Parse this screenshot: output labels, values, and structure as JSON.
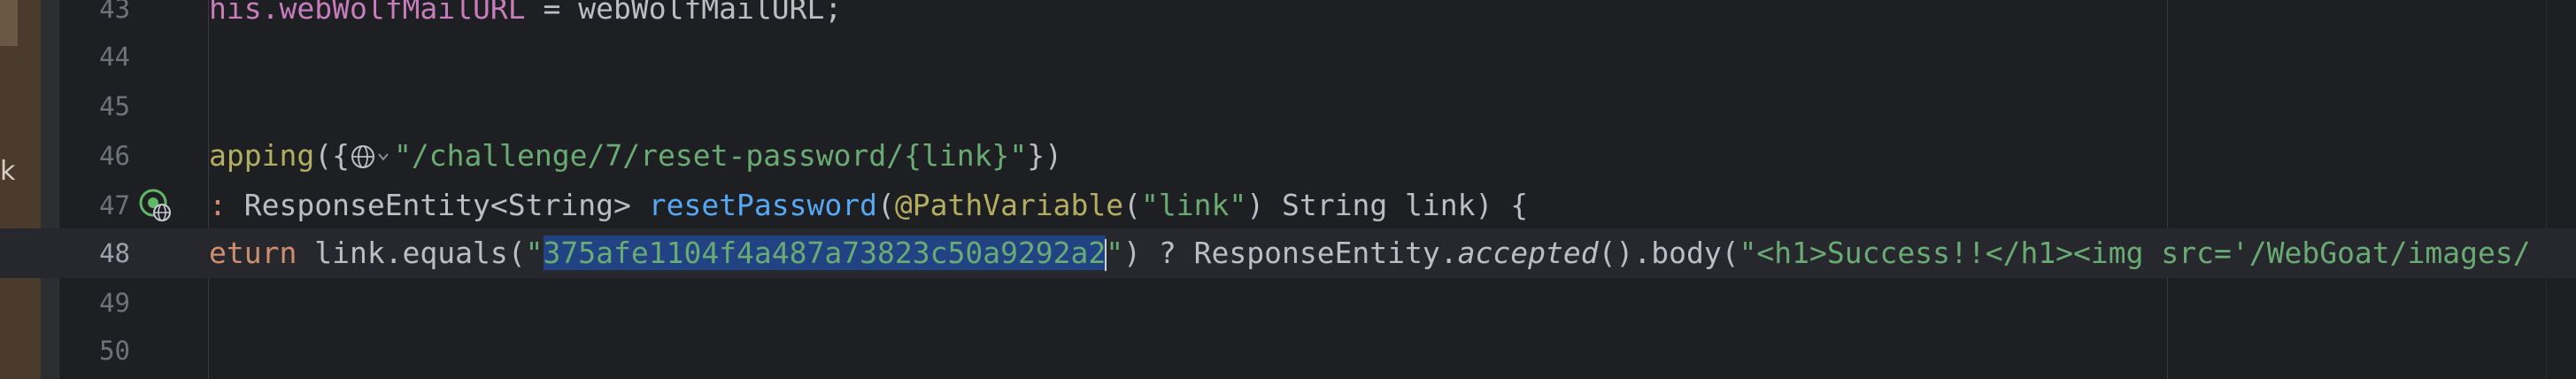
{
  "sidebar": {
    "label": "k"
  },
  "editor": {
    "lines": [
      {
        "number": "43",
        "segments": [
          {
            "cls": "field",
            "text": "his.webWolfMailURL"
          },
          {
            "cls": "",
            "text": " = webWolfMailURL;"
          }
        ]
      },
      {
        "number": "44",
        "segments": []
      },
      {
        "number": "45",
        "segments": []
      },
      {
        "number": "46",
        "segments": [
          {
            "cls": "ann",
            "text": "apping"
          },
          {
            "cls": "",
            "text": "({"
          },
          {
            "cls": "icon",
            "text": ""
          },
          {
            "cls": "str",
            "text": "\"/challenge/7/reset-password/{link}\""
          },
          {
            "cls": "",
            "text": "})"
          }
        ]
      },
      {
        "number": "47",
        "segments": [
          {
            "cls": "kw",
            "text": ": "
          },
          {
            "cls": "",
            "text": "ResponseEntity<String> "
          },
          {
            "cls": "fn",
            "text": "resetPassword"
          },
          {
            "cls": "",
            "text": "("
          },
          {
            "cls": "ann",
            "text": "@PathVariable"
          },
          {
            "cls": "",
            "text": "("
          },
          {
            "cls": "str",
            "text": "\"link\""
          },
          {
            "cls": "",
            "text": ") String link) {"
          }
        ]
      },
      {
        "number": "48",
        "current": true,
        "segments": [
          {
            "cls": "kw",
            "text": "eturn "
          },
          {
            "cls": "",
            "text": "link.equals("
          },
          {
            "cls": "str",
            "text": "\""
          },
          {
            "cls": "sel",
            "text": "375afe1104f4a487a73823c50a9292a2"
          },
          {
            "cls": "caret",
            "text": ""
          },
          {
            "cls": "str",
            "text": "\""
          },
          {
            "cls": "",
            "text": ") ? ResponseEntity."
          },
          {
            "cls": "ital",
            "text": "accepted"
          },
          {
            "cls": "",
            "text": "().body("
          },
          {
            "cls": "str",
            "text": "\"<h1>Success!!</h1><img src='/WebGoat/images/"
          }
        ]
      },
      {
        "number": "49",
        "segments": []
      },
      {
        "number": "50",
        "segments": []
      }
    ]
  },
  "colors": {
    "background": "#1e1f22",
    "keyword": "#cf8e6d",
    "string": "#6aab73",
    "annotation": "#b3ae60",
    "function": "#56a8f5",
    "field": "#c77dbb",
    "selection": "#214283"
  },
  "icons": {
    "gutter": "web-endpoint-icon",
    "inline": "globe-icon"
  }
}
